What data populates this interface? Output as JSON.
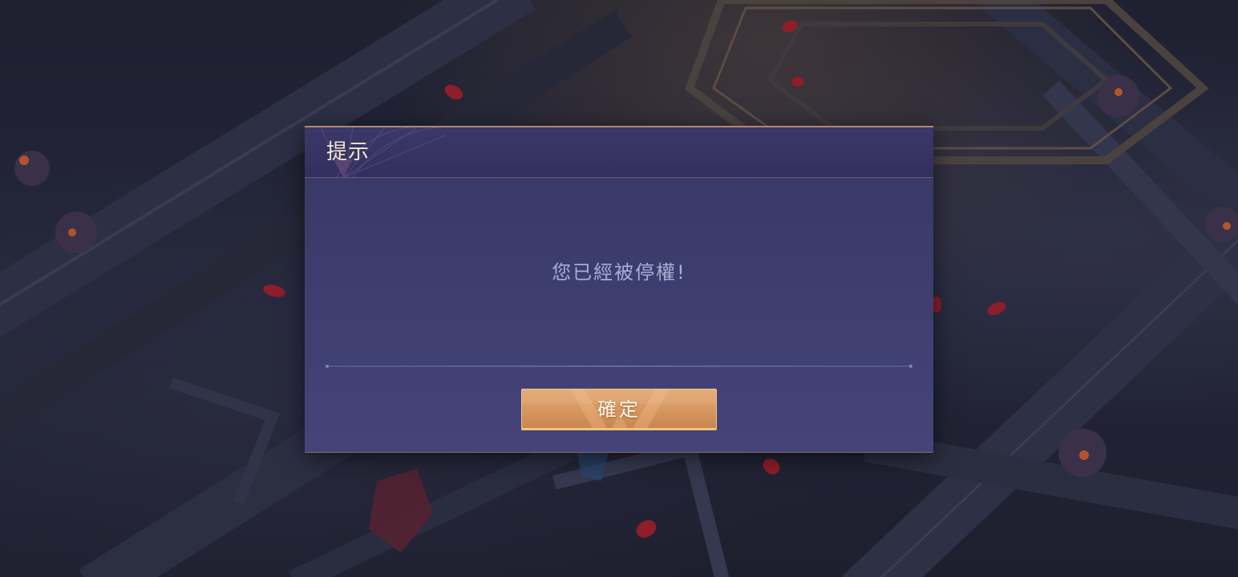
{
  "dialog": {
    "title": "提示",
    "message": "您已經被停權!",
    "confirm_label": "確定"
  },
  "colors": {
    "dialog_bg": "#3e3e70",
    "dialog_border": "#b4876b",
    "title_text": "#f1e6cf",
    "message_text": "#a9aed6",
    "button_bg": "#d89a63",
    "button_text": "#fff8ee"
  }
}
